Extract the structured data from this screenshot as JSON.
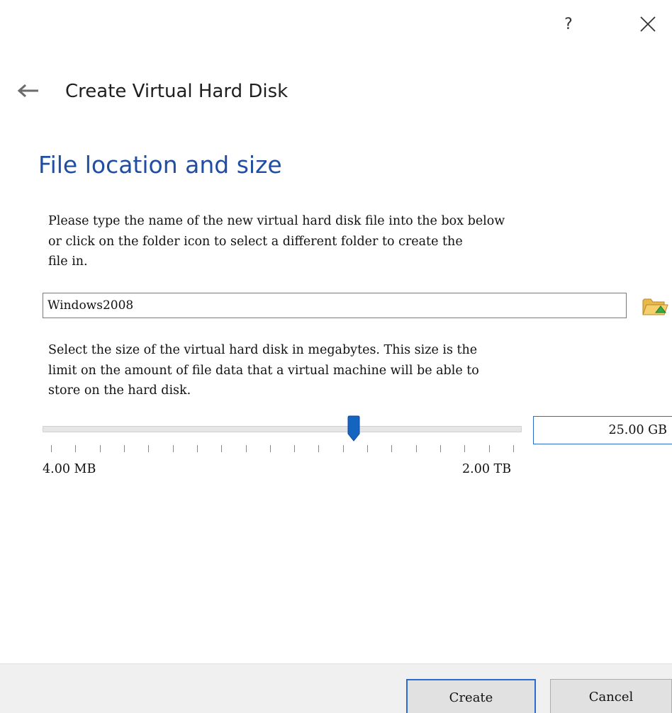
{
  "titlebar": {
    "help_label": "?",
    "close_icon": "close-icon"
  },
  "header": {
    "back_icon": "back-arrow-icon",
    "wizard_title": "Create Virtual Hard Disk"
  },
  "page": {
    "heading": "File location and size",
    "location_text": "Please type the name of the new virtual hard disk file into the box below\nor click on the folder icon to select a different folder to create the\nfile in.",
    "file_name_value": "Windows2008",
    "folder_icon": "folder-open-icon",
    "size_text": "Select the size of the virtual hard disk in megabytes. This size is the\nlimit on the amount of file data that a virtual machine will be able to\nstore on the hard disk.",
    "size": {
      "value": "25.00 GB",
      "min_label": "4.00 MB",
      "max_label": "2.00 TB",
      "slider_fraction": 0.655,
      "tick_count": 20
    }
  },
  "footer": {
    "create_label": "Create",
    "cancel_label": "Cancel"
  },
  "colors": {
    "accent": "#1f4ea3",
    "focus_border": "#2a6bd0",
    "slider_handle": "#1565c0"
  }
}
